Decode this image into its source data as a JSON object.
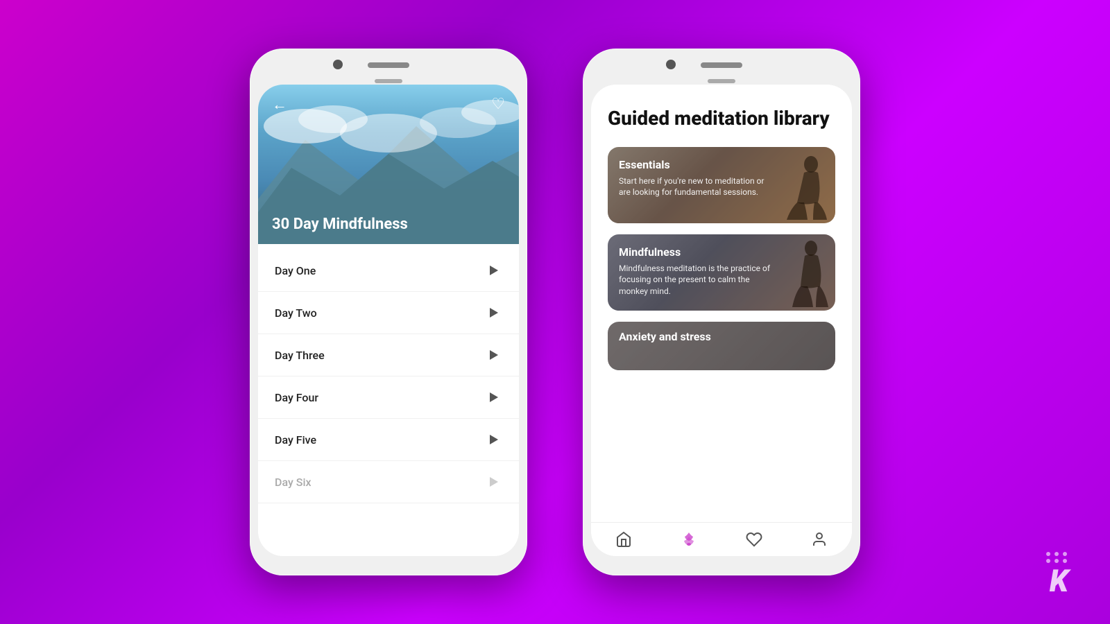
{
  "background": {
    "gradient_start": "#cc00cc",
    "gradient_end": "#aa00dd"
  },
  "left_phone": {
    "hero_title": "30 Day Mindfulness",
    "back_icon": "←",
    "heart_icon": "♡",
    "days": [
      {
        "label": "Day One",
        "active": true,
        "dimmed": false
      },
      {
        "label": "Day Two",
        "active": false,
        "dimmed": false
      },
      {
        "label": "Day Three",
        "active": false,
        "dimmed": false
      },
      {
        "label": "Day Four",
        "active": false,
        "dimmed": false
      },
      {
        "label": "Day Five",
        "active": false,
        "dimmed": false
      },
      {
        "label": "Day Six",
        "active": false,
        "dimmed": true
      }
    ]
  },
  "right_phone": {
    "library_title": "Guided meditation library",
    "categories": [
      {
        "id": "essentials",
        "title": "Essentials",
        "description": "Start here if you're new to meditation or are looking for fundamental sessions."
      },
      {
        "id": "mindfulness",
        "title": "Mindfulness",
        "description": "Mindfulness meditation is the practice of focusing on the present to calm the monkey mind."
      },
      {
        "id": "anxiety",
        "title": "Anxiety and stress",
        "description": ""
      }
    ],
    "nav_items": [
      {
        "icon": "home",
        "label": "Home",
        "active": false
      },
      {
        "icon": "lotus",
        "label": "Meditate",
        "active": true
      },
      {
        "icon": "heart",
        "label": "Favorites",
        "active": false
      },
      {
        "icon": "person",
        "label": "Profile",
        "active": false
      }
    ]
  },
  "watermark": "K"
}
